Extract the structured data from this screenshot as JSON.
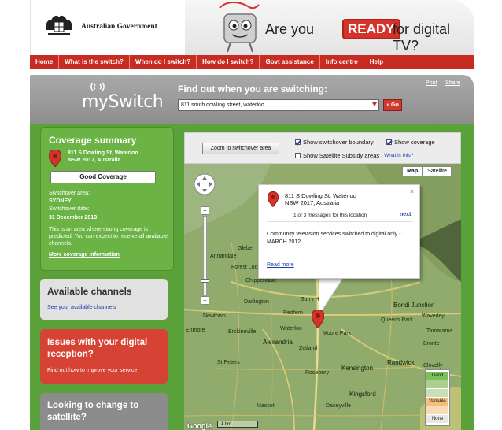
{
  "header": {
    "government_name": "Australian Government",
    "promo_lead": "Are you",
    "promo_badge": "READY",
    "promo_tail": "for digital TV?"
  },
  "nav": {
    "items": [
      "Home",
      "What is the switch?",
      "When do I switch?",
      "How do I switch?",
      "Govt assistance",
      "Info centre",
      "Help"
    ]
  },
  "myswitch": {
    "logo": "mySwitch",
    "find_title": "Find out when you are switching:",
    "address_value": "811 south dowling street, waterloo",
    "go_label": "» Go",
    "print_label": "Print",
    "share_label": "Share"
  },
  "coverage_summary": {
    "title": "Coverage summary",
    "address_line1": "811 S Dowling St, Waterloo",
    "address_line2": "NSW 2017, Australia",
    "coverage_label": "Good Coverage",
    "area_label": "Switchover area:",
    "area_value": "SYDNEY",
    "date_label": "Switchover date:",
    "date_value": "31 December 2013",
    "description_lines": [
      "This is an area where strong coverage is",
      "predicted. You can expect to receive all available",
      "channels."
    ],
    "more_link": "More coverage information"
  },
  "available_channels": {
    "title": "Available channels",
    "link": "See your available channels"
  },
  "issues": {
    "title": "Issues with your digital reception?",
    "link": "Find out how to improve your service"
  },
  "satellite": {
    "title": "Looking to change to satellite?"
  },
  "controls": {
    "zoom_button": "Zoom to switchover area",
    "show_boundary": "Show switchover boundary",
    "show_coverage": "Show coverage",
    "show_subsidy": "Show Satellite Subsidy areas",
    "what_is_this": "What is this?"
  },
  "map": {
    "tab_map": "Map",
    "tab_satellite": "Satellite",
    "labels": {
      "annandale": "Annandale",
      "forest_lodge": "Forest Lodge",
      "glebe": "Glebe",
      "chippendale": "Chippendale",
      "darlington": "Darlington",
      "newtown": "Newtown",
      "enmore": "Enmore",
      "erskineville": "Erskineville",
      "surry_hills": "Surry Hills",
      "redfern": "Redfern",
      "waterloo": "Waterloo",
      "moore_park": "Moore Park",
      "zetland": "Zetland",
      "alexandria": "Alexandria",
      "st_peters": "St Peters",
      "rosebery": "Rosebery",
      "kensington": "Kensington",
      "kingsford": "Kingsford",
      "daceyville": "Daceyville",
      "randwick": "Randwick",
      "queens_park": "Queens Park",
      "bondi_junction": "Bondi Junction",
      "tamarama": "Tamarama",
      "bronte": "Bronte",
      "clovelly": "Clovelly",
      "mascot": "Mascot",
      "waverley": "Waverley"
    },
    "google": "Google",
    "scale": "1 km"
  },
  "popup": {
    "address_line1": "811 S Dowling St, Waterloo",
    "address_line2": "NSW 2017, Australia",
    "count": "1 of 3 messages for this location",
    "next": "next",
    "message": "Community television services switched to digital only - 1 MARCH 2012",
    "read_more": "Read more"
  },
  "legend": {
    "good": "Good",
    "variable": "Variable",
    "none": "None"
  },
  "colors": {
    "brand_red": "#c72b22",
    "panel_green": "#6ab344",
    "map_green": "#8ca869"
  }
}
